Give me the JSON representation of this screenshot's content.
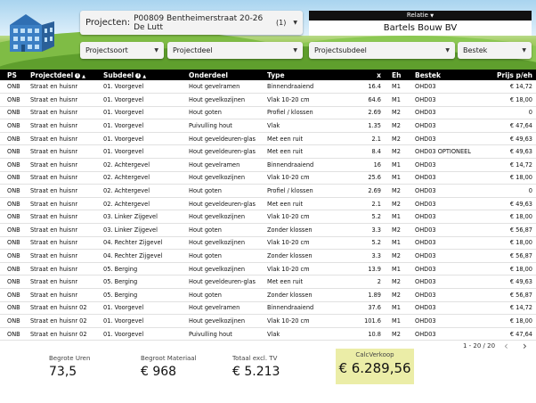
{
  "header": {
    "project_label": "Projecten:",
    "project_value": "P00809 Bentheimerstraat 20-26 De Lutt",
    "project_count": "(1)",
    "relatie_label": "Relatie",
    "relatie_value": "Bartels Bouw BV"
  },
  "filters": {
    "projectsoort": "Projectsoort",
    "projectdeel": "Projectdeel",
    "projectsubdeel": "Projectsubdeel",
    "bestek": "Bestek"
  },
  "table": {
    "columns": [
      "PS",
      "Projectdeel",
      "Subdeel",
      "Onderdeel",
      "Type",
      "x",
      "Eh",
      "Bestek",
      "Prijs p/eh"
    ],
    "rows": [
      [
        "ONB",
        "Straat en huisnr",
        "01. Voorgevel",
        "Hout gevelramen",
        "Binnendraaiend",
        "16.4",
        "M1",
        "OHD03",
        "€ 14,72"
      ],
      [
        "ONB",
        "Straat en huisnr",
        "01. Voorgevel",
        "Hout gevelkozijnen",
        "Vlak 10-20 cm",
        "64.6",
        "M1",
        "OHD03",
        "€ 18,00"
      ],
      [
        "ONB",
        "Straat en huisnr",
        "01. Voorgevel",
        "Hout goten",
        "Profiel / klossen",
        "2.69",
        "M2",
        "OHD03",
        "0"
      ],
      [
        "ONB",
        "Straat en huisnr",
        "01. Voorgevel",
        "Puivulling hout",
        "Vlak",
        "1.35",
        "M2",
        "OHD03",
        "€ 47,64"
      ],
      [
        "ONB",
        "Straat en huisnr",
        "01. Voorgevel",
        "Hout geveldeuren-glas",
        "Met een ruit",
        "2.1",
        "M2",
        "OHD03",
        "€ 49,63"
      ],
      [
        "ONB",
        "Straat en huisnr",
        "01. Voorgevel",
        "Hout geveldeuren-glas",
        "Met een ruit",
        "8.4",
        "M2",
        "OHD03 OPTIONEEL",
        "€ 49,63"
      ],
      [
        "ONB",
        "Straat en huisnr",
        "02. Achtergevel",
        "Hout gevelramen",
        "Binnendraaiend",
        "16",
        "M1",
        "OHD03",
        "€ 14,72"
      ],
      [
        "ONB",
        "Straat en huisnr",
        "02. Achtergevel",
        "Hout gevelkozijnen",
        "Vlak 10-20 cm",
        "25.6",
        "M1",
        "OHD03",
        "€ 18,00"
      ],
      [
        "ONB",
        "Straat en huisnr",
        "02. Achtergevel",
        "Hout goten",
        "Profiel / klossen",
        "2.69",
        "M2",
        "OHD03",
        "0"
      ],
      [
        "ONB",
        "Straat en huisnr",
        "02. Achtergevel",
        "Hout geveldeuren-glas",
        "Met een ruit",
        "2.1",
        "M2",
        "OHD03",
        "€ 49,63"
      ],
      [
        "ONB",
        "Straat en huisnr",
        "03. Linker Zijgevel",
        "Hout gevelkozijnen",
        "Vlak 10-20 cm",
        "5.2",
        "M1",
        "OHD03",
        "€ 18,00"
      ],
      [
        "ONB",
        "Straat en huisnr",
        "03. Linker Zijgevel",
        "Hout goten",
        "Zonder klossen",
        "3.3",
        "M2",
        "OHD03",
        "€ 56,87"
      ],
      [
        "ONB",
        "Straat en huisnr",
        "04. Rechter Zijgevel",
        "Hout gevelkozijnen",
        "Vlak 10-20 cm",
        "5.2",
        "M1",
        "OHD03",
        "€ 18,00"
      ],
      [
        "ONB",
        "Straat en huisnr",
        "04. Rechter Zijgevel",
        "Hout goten",
        "Zonder klossen",
        "3.3",
        "M2",
        "OHD03",
        "€ 56,87"
      ],
      [
        "ONB",
        "Straat en huisnr",
        "05. Berging",
        "Hout gevelkozijnen",
        "Vlak 10-20 cm",
        "13.9",
        "M1",
        "OHD03",
        "€ 18,00"
      ],
      [
        "ONB",
        "Straat en huisnr",
        "05. Berging",
        "Hout geveldeuren-glas",
        "Met een ruit",
        "2",
        "M2",
        "OHD03",
        "€ 49,63"
      ],
      [
        "ONB",
        "Straat en huisnr",
        "05. Berging",
        "Hout goten",
        "Zonder klossen",
        "1.89",
        "M2",
        "OHD03",
        "€ 56,87"
      ],
      [
        "ONB",
        "Straat en huisnr 02",
        "01. Voorgevel",
        "Hout gevelramen",
        "Binnendraaiend",
        "37.6",
        "M1",
        "OHD03",
        "€ 14,72"
      ],
      [
        "ONB",
        "Straat en huisnr 02",
        "01. Voorgevel",
        "Hout gevelkozijnen",
        "Vlak 10-20 cm",
        "101.6",
        "M1",
        "OHD03",
        "€ 18,00"
      ],
      [
        "ONB",
        "Straat en huisnr 02",
        "01. Voorgevel",
        "Puivulling hout",
        "Vlak",
        "10.8",
        "M2",
        "OHD03",
        "€ 47,64"
      ]
    ]
  },
  "pager": {
    "text": "1 - 20 / 20",
    "prev": "‹",
    "next": "›"
  },
  "summary": {
    "uren_label": "Begrote Uren",
    "uren_value": "73,5",
    "materiaal_label": "Begroot Materiaal",
    "materiaal_value": "€ 968",
    "totaal_label": "Totaal excl. TV",
    "totaal_value": "€ 5.213",
    "calc_label": "CalcVerkoop",
    "calc_value": "€ 6.289,56"
  },
  "colors": {
    "header_black": "#000000",
    "calc_bg": "#ebeda7",
    "grass": "#6aaa35",
    "house_blue": "#3b7fc4"
  },
  "icons": {
    "logo": "house-icon",
    "caret": "caret-down-icon",
    "info": "info-icon",
    "sort": "sort-up-icon"
  }
}
